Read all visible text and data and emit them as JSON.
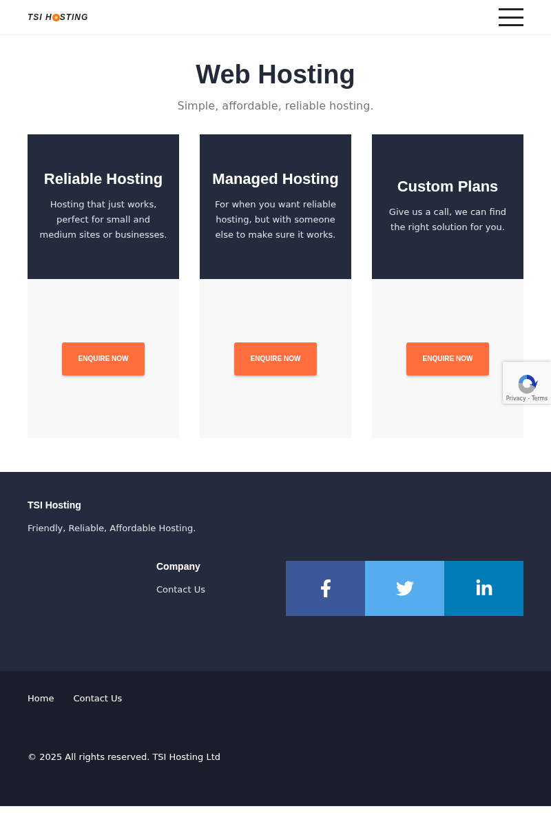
{
  "header": {
    "logo": {
      "before": "TSI H",
      "after": "STING"
    }
  },
  "hero": {
    "title": "Web Hosting",
    "subtitle": "Simple, affordable, reliable hosting."
  },
  "plans": [
    {
      "title": "Reliable Hosting",
      "description": "Hosting that just works, perfect for small and medium sites or businesses.",
      "button": "ENQUIRE NOW"
    },
    {
      "title": "Managed Hosting",
      "description": "For when you want reliable hosting, but with someone else to make sure it works.",
      "button": "ENQUIRE NOW"
    },
    {
      "title": "Custom Plans",
      "description": "Give us a call, we can find the right solution for you.",
      "button": "ENQUIRE NOW"
    }
  ],
  "recaptcha": {
    "links": "Privacy - Terms"
  },
  "footer": {
    "brand": "TSI Hosting",
    "tagline": "Friendly, Reliable, Affordable Hosting.",
    "column_title": "Company",
    "column_links": [
      "Contact Us"
    ],
    "social": [
      {
        "kind": "facebook",
        "color": "#3b5998"
      },
      {
        "kind": "twitter",
        "color": "#55acee"
      },
      {
        "kind": "linkedin",
        "color": "#007bb5"
      }
    ]
  },
  "bottom": {
    "links": [
      "Home",
      "Contact Us"
    ],
    "copyright": "© 2025 All rights reserved. TSI Hosting Ltd"
  }
}
